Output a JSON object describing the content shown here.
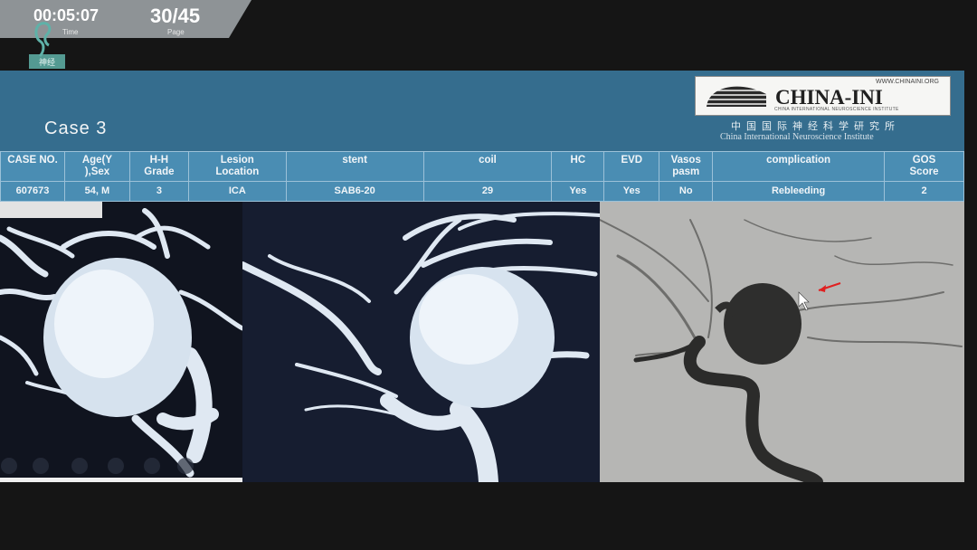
{
  "player": {
    "time": "00:05:07",
    "time_label": "Time",
    "page": "30/45",
    "page_label": "Page"
  },
  "corner_logo": {
    "icon": "institute-logo-icon"
  },
  "slide": {
    "title": "Case  3",
    "brand": {
      "url": "WWW.CHINAINI.ORG",
      "name": "CHINA-INI",
      "sub": "CHINA INTERNATIONAL NEUROSCIENCE INSTITUTE",
      "cn": "中国国际神经科学研究所",
      "en": "China International Neuroscience Institute"
    },
    "table": {
      "headers": [
        [
          "CASE NO.",
          ""
        ],
        [
          "Age(Y",
          "),Sex"
        ],
        [
          "H-H",
          "Grade"
        ],
        [
          "Lesion",
          "Location"
        ],
        [
          "stent",
          ""
        ],
        [
          "coil",
          ""
        ],
        [
          "HC",
          ""
        ],
        [
          "EVD",
          ""
        ],
        [
          "Vasos",
          "pasm"
        ],
        [
          "complication",
          ""
        ],
        [
          "GOS",
          "Score"
        ]
      ],
      "row": [
        "607673",
        "54, M",
        "3",
        "ICA",
        "SAB6-20",
        "29",
        "Yes",
        "Yes",
        "No",
        "Rebleeding",
        "2"
      ]
    },
    "images": {
      "left": "3D angiography reconstruction of ICA aneurysm, lateral view",
      "middle": "3D angiography reconstruction of ICA aneurysm, oblique view",
      "right": "DSA angiogram showing aneurysm with arrow"
    }
  },
  "colors": {
    "header_blue": "#356d8e",
    "table_blue": "#4a8db3",
    "player_gray": "#8e9396"
  }
}
